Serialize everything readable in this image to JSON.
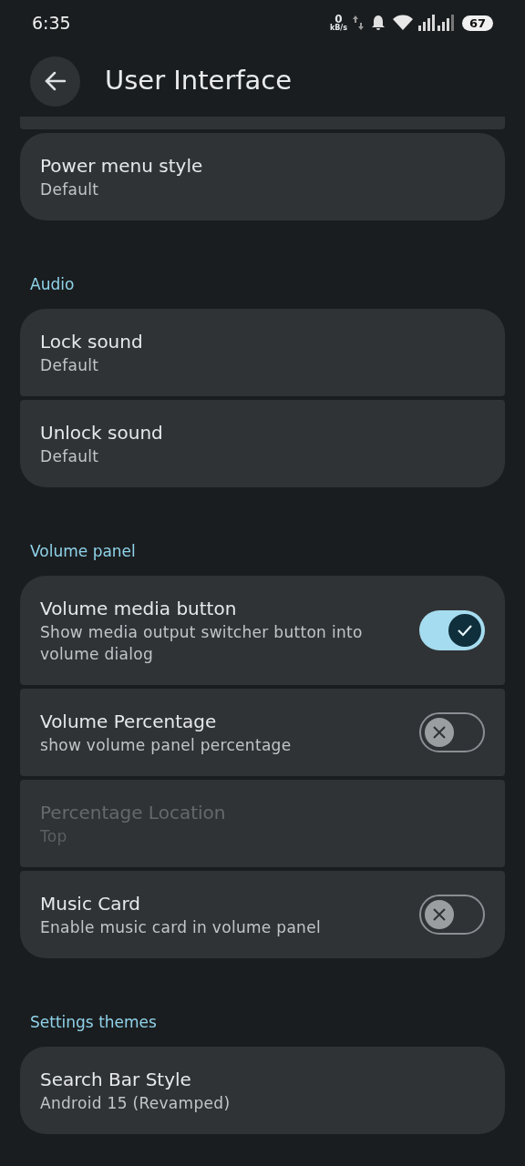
{
  "status_bar": {
    "time": "6:35",
    "net_speed": "0",
    "net_unit": "kB/s",
    "battery": "67"
  },
  "header": {
    "title": "User Interface"
  },
  "sections": [
    {
      "items": [
        {
          "kind": "item",
          "title": "Power menu style",
          "subtitle": "Default",
          "disabled": false
        }
      ]
    },
    {
      "title": "Audio",
      "items": [
        {
          "kind": "item",
          "title": "Lock sound",
          "subtitle": "Default",
          "disabled": false
        },
        {
          "kind": "item",
          "title": "Unlock sound",
          "subtitle": "Default",
          "disabled": false
        }
      ]
    },
    {
      "title": "Volume panel",
      "items": [
        {
          "kind": "switch",
          "title": "Volume media button",
          "subtitle": "Show media output switcher button into volume dialog",
          "checked": true,
          "disabled": false
        },
        {
          "kind": "switch",
          "title": "Volume Percentage",
          "subtitle": "show volume panel percentage",
          "checked": false,
          "disabled": false
        },
        {
          "kind": "item",
          "title": "Percentage Location",
          "subtitle": "Top",
          "disabled": true
        },
        {
          "kind": "switch",
          "title": "Music Card",
          "subtitle": "Enable music card in volume panel",
          "checked": false,
          "disabled": false
        }
      ]
    },
    {
      "title": "Settings themes",
      "items": [
        {
          "kind": "item",
          "title": "Search Bar Style",
          "subtitle": "Android 15 (Revamped)",
          "disabled": false
        }
      ]
    }
  ]
}
